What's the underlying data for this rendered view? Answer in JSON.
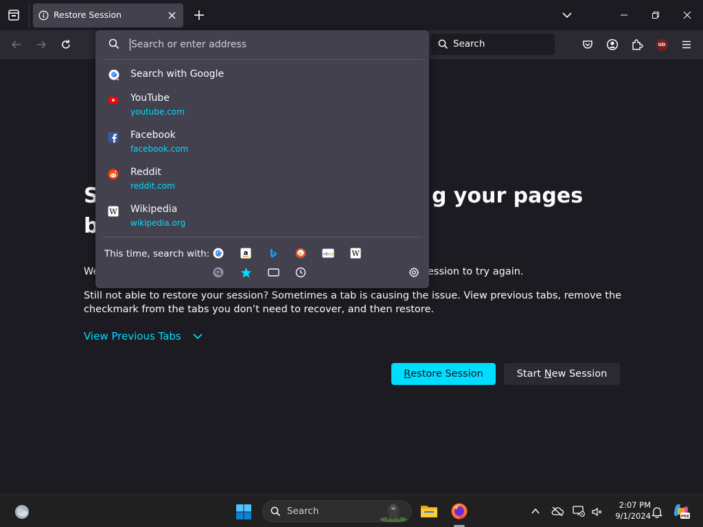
{
  "tab": {
    "title": "Restore Session"
  },
  "navbar": {
    "search_label": "Search",
    "ublock_label": "UD"
  },
  "urlbar": {
    "placeholder": "Search or enter address"
  },
  "results": [
    {
      "title": "Search with Google",
      "url": "",
      "icon": "google-icon"
    },
    {
      "title": "YouTube",
      "url": "youtube.com",
      "icon": "youtube-icon"
    },
    {
      "title": "Facebook",
      "url": "facebook.com",
      "icon": "facebook-icon"
    },
    {
      "title": "Reddit",
      "url": "reddit.com",
      "icon": "reddit-icon"
    },
    {
      "title": "Wikipedia",
      "url": "wikipedia.org",
      "icon": "wikipedia-icon"
    }
  ],
  "one_off": {
    "label": "This time, search with:",
    "engines": [
      "google-icon",
      "amazon-icon",
      "bing-icon",
      "duckduckgo-icon",
      "ebay-icon",
      "wikipedia-icon"
    ],
    "modes": [
      "search-engine-icon",
      "bookmarks-star-icon",
      "tabs-icon",
      "history-icon"
    ]
  },
  "page": {
    "headline_line1": "S",
    "headline_line1_tail": "g your pages",
    "headline_line2": "b",
    "para1_head": "We",
    "para1_tail": "ession to try again.",
    "para2": "Still not able to restore your session? Sometimes a tab is causing the issue. View previous tabs, remove the checkmark from the tabs you don’t need to recover, and then restore.",
    "view_previous": "View Previous Tabs",
    "restore_button": {
      "pre": "",
      "access": "R",
      "post": "estore Session"
    },
    "new_button": {
      "pre": "Start ",
      "access": "N",
      "post": "ew Session"
    }
  },
  "taskbar": {
    "search_label": "Search",
    "time": "2:07 PM",
    "date": "9/1/2024"
  },
  "colors": {
    "accent": "#00ddff",
    "tab_bg": "#42414d",
    "page_bg": "#1c1b22",
    "ublock": "#7b1e1e"
  }
}
